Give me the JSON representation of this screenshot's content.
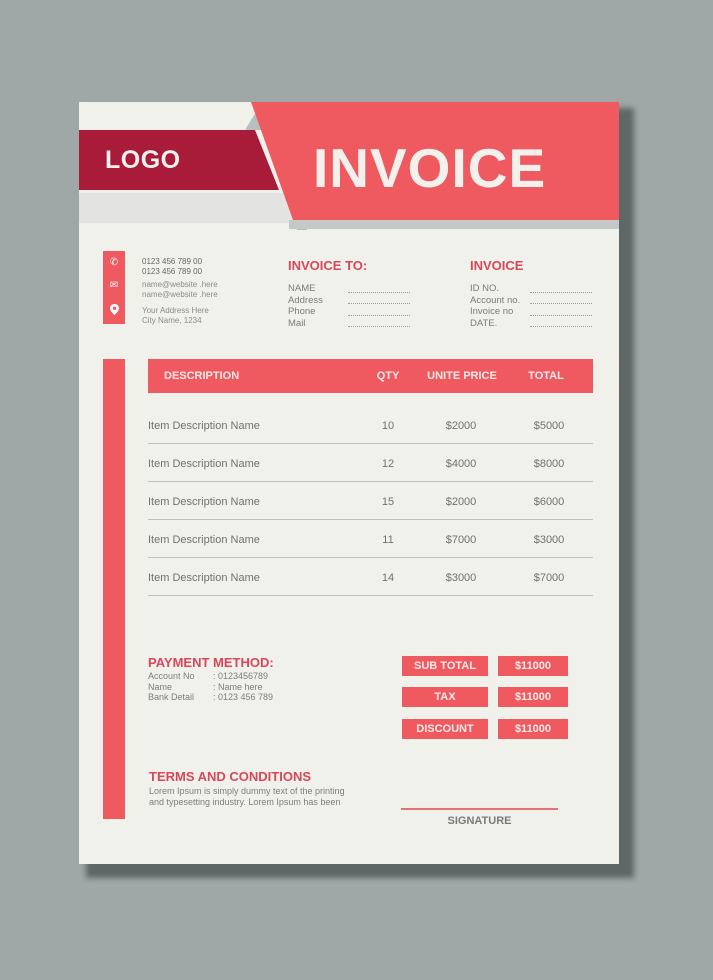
{
  "header": {
    "logo": "LOGO",
    "title": "INVOICE"
  },
  "contact": {
    "icons": [
      "phone-icon",
      "mail-icon",
      "location-pin-icon"
    ],
    "icon_glyphs": [
      "✆",
      "✉",
      "⚲"
    ],
    "phones": [
      "0123 456 789 00",
      "0123 456 789 00"
    ],
    "emails": [
      "name@website .here",
      "name@website .here"
    ],
    "address": [
      "Your Address Here",
      "City Name, 1234"
    ]
  },
  "invoice_to": {
    "title": "INVOICE TO:",
    "fields": [
      "NAME",
      "Address",
      "Phone",
      "Mail"
    ]
  },
  "invoice_info": {
    "title": "INVOICE",
    "fields": [
      "ID NO.",
      "Account no.",
      "Invoice no",
      "DATE."
    ]
  },
  "table": {
    "headers": {
      "description": "DESCRIPTION",
      "qty": "QTY",
      "price": "UNITE PRICE",
      "total": "TOTAL"
    },
    "rows": [
      {
        "description": "Item Description Name",
        "qty": "10",
        "price": "$2000",
        "total": "$5000"
      },
      {
        "description": "Item Description Name",
        "qty": "12",
        "price": "$4000",
        "total": "$8000"
      },
      {
        "description": "Item Description Name",
        "qty": "15",
        "price": "$2000",
        "total": "$6000"
      },
      {
        "description": "Item Description Name",
        "qty": "11",
        "price": "$7000",
        "total": "$3000"
      },
      {
        "description": "Item Description Name",
        "qty": "14",
        "price": "$3000",
        "total": "$7000"
      }
    ]
  },
  "payment": {
    "title": "PAYMENT METHOD:",
    "rows": [
      {
        "label": "Account No",
        "value": ": 0123456789"
      },
      {
        "label": "Name",
        "value": ": Name here"
      },
      {
        "label": "Bank Detail",
        "value": ": 0123 456 789"
      }
    ]
  },
  "totals": [
    {
      "label": "SUB TOTAL",
      "value": "$11000"
    },
    {
      "label": "TAX",
      "value": "$11000"
    },
    {
      "label": "DISCOUNT",
      "value": "$11000"
    }
  ],
  "terms": {
    "title": "TERMS AND CONDITIONS",
    "text": "Lorem Ipsum is simply dummy text of the printing and typesetting industry. Lorem Ipsum has been"
  },
  "signature": {
    "label": "SIGNATURE"
  },
  "colors": {
    "accent": "#ef5a60",
    "dark_accent": "#a81c3a",
    "heading": "#d9475a",
    "page": "#f1f1ec",
    "background": "#a0a8a7"
  }
}
